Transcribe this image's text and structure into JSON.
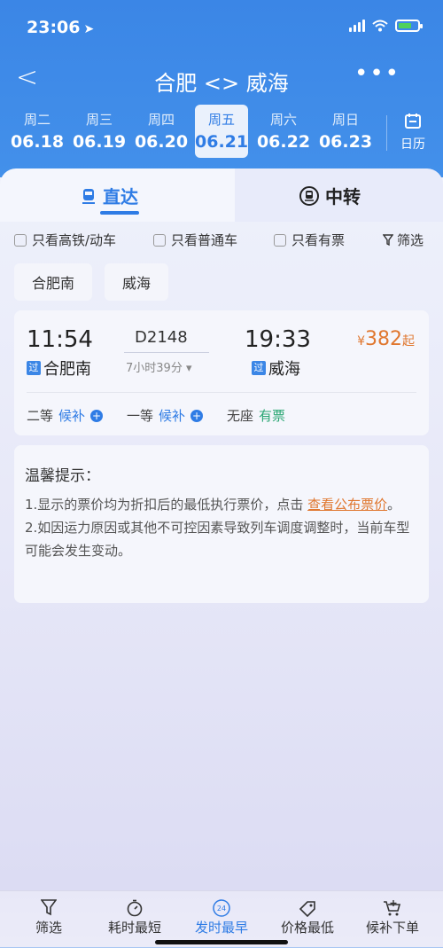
{
  "status": {
    "time": "23:06"
  },
  "nav": {
    "back": "<",
    "title": "合肥 <> 威海",
    "more": "•••"
  },
  "dates": [
    {
      "weekday": "周二",
      "date": "06.18"
    },
    {
      "weekday": "周三",
      "date": "06.19"
    },
    {
      "weekday": "周四",
      "date": "06.20"
    },
    {
      "weekday": "周五",
      "date": "06.21"
    },
    {
      "weekday": "周六",
      "date": "06.22"
    },
    {
      "weekday": "周日",
      "date": "06.23"
    }
  ],
  "calendar_label": "日历",
  "tabs": {
    "direct": "直达",
    "transfer": "中转"
  },
  "filters": {
    "high_speed": "只看高铁/动车",
    "regular": "只看普通车",
    "available": "只看有票",
    "filter": "筛选"
  },
  "stations": {
    "from": "合肥南",
    "to": "威海"
  },
  "train": {
    "dep_time": "11:54",
    "dep_station": "合肥南",
    "via_badge": "过",
    "number": "D2148",
    "duration": "7小时39分",
    "arr_time": "19:33",
    "arr_station": "威海",
    "price_currency": "¥",
    "price": "382",
    "price_suffix": "起",
    "seats": [
      {
        "class": "二等",
        "status": "候补"
      },
      {
        "class": "一等",
        "status": "候补"
      },
      {
        "class": "无座",
        "status": "有票"
      }
    ]
  },
  "tips": {
    "title": "温馨提示：",
    "line1_pre": "1.显示的票价均为折扣后的最低执行票价，点击 ",
    "line1_link": "查看公布票价",
    "line1_post": "。",
    "line2": "2.如因运力原因或其他不可控因素导致列车调度调整时，当前车型可能会发生变动。"
  },
  "bottom": {
    "filter": "筛选",
    "shortest": "耗时最短",
    "earliest": "发时最早",
    "cheapest": "价格最低",
    "waitlist": "候补下单"
  },
  "colors": {
    "primary": "#2f7ce5",
    "price": "#e0772f",
    "available": "#2aa673"
  }
}
